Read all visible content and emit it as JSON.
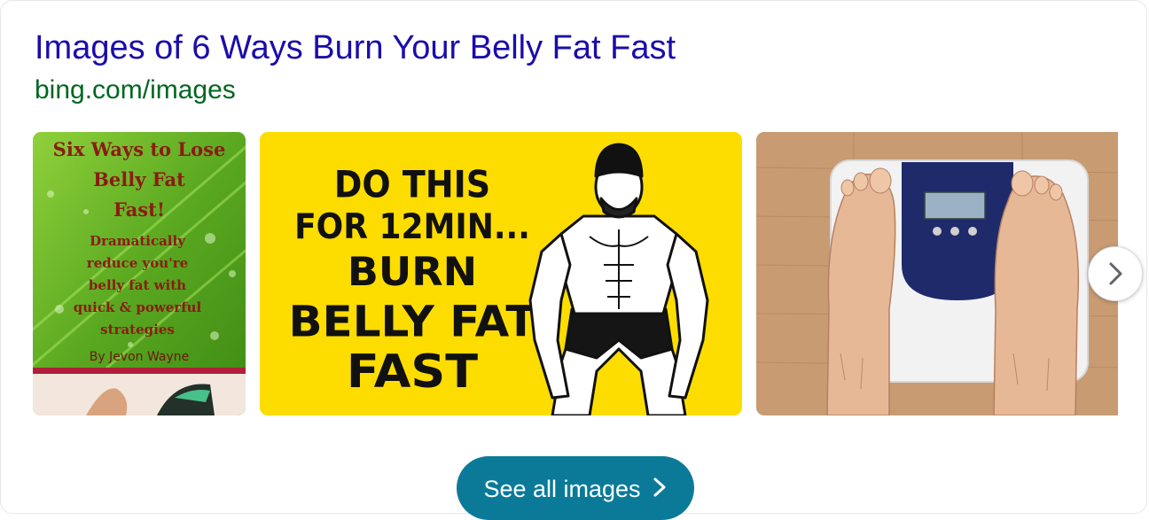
{
  "header": {
    "title": "Images of 6 Ways Burn Your Belly Fat Fast",
    "source_url": "bing.com/images"
  },
  "carousel": {
    "images": [
      {
        "name": "ebook-cover",
        "lines": [
          "Six Ways to Lose",
          "Belly Fat",
          "Fast!"
        ],
        "body_lines": [
          "Dramatically",
          "reduce you're",
          "belly fat with",
          "quick & powerful",
          "strategies"
        ],
        "byline": "By Jevon Wayne",
        "bg_color": "#6dbb2a"
      },
      {
        "name": "workout-promo",
        "top_lines": [
          "DO THIS",
          "FOR 12MIN..."
        ],
        "main_lines": [
          "BURN",
          "BELLY FAT",
          "FAST"
        ],
        "bg_color": "#fddd00"
      },
      {
        "name": "scale-feet",
        "bg_color": "#c89b73"
      }
    ],
    "next_icon": "chevron-right-icon"
  },
  "footer": {
    "see_all_label": "See all images",
    "see_all_icon": "chevron-right-icon",
    "button_color": "#0b7a99"
  }
}
